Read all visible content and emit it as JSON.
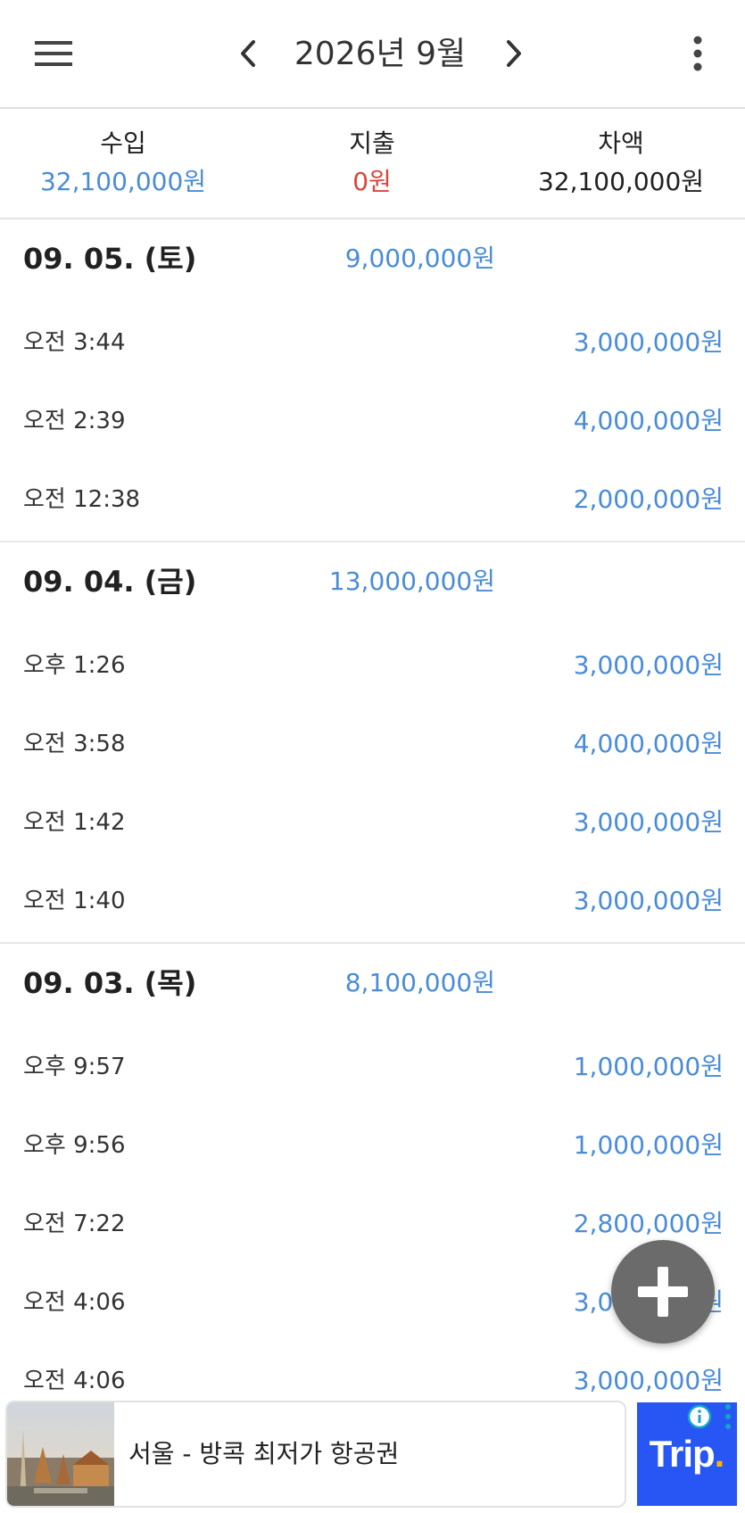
{
  "header": {
    "title": "2026년 9월",
    "menu_icon": "hamburger-menu-icon",
    "prev_icon": "chevron-left-icon",
    "next_icon": "chevron-right-icon",
    "more_icon": "more-vertical-icon"
  },
  "summary": {
    "income_label": "수입",
    "income_value": "32,100,000원",
    "expense_label": "지출",
    "expense_value": "0원",
    "balance_label": "차액",
    "balance_value": "32,100,000원"
  },
  "colors": {
    "income": "#4a8cd6",
    "expense": "#d9453b",
    "fab": "#6b6b6b",
    "ad_logo_bg": "#2756f5"
  },
  "days": [
    {
      "date": "09. 05. (토)",
      "total": "9,000,000원",
      "transactions": [
        {
          "time": "오전 3:44",
          "amount": "3,000,000원"
        },
        {
          "time": "오전 2:39",
          "amount": "4,000,000원"
        },
        {
          "time": "오전 12:38",
          "amount": "2,000,000원"
        }
      ]
    },
    {
      "date": "09. 04. (금)",
      "total": "13,000,000원",
      "transactions": [
        {
          "time": "오후 1:26",
          "amount": "3,000,000원"
        },
        {
          "time": "오전 3:58",
          "amount": "4,000,000원"
        },
        {
          "time": "오전 1:42",
          "amount": "3,000,000원"
        },
        {
          "time": "오전 1:40",
          "amount": "3,000,000원"
        }
      ]
    },
    {
      "date": "09. 03. (목)",
      "total": "8,100,000원",
      "transactions": [
        {
          "time": "오후 9:57",
          "amount": "1,000,000원"
        },
        {
          "time": "오후 9:56",
          "amount": "1,000,000원"
        },
        {
          "time": "오전 7:22",
          "amount": "2,800,000원"
        },
        {
          "time": "오전 4:06",
          "amount": "3,000,000원"
        },
        {
          "time": "오전 4:06",
          "amount": "3,000,000원"
        }
      ]
    }
  ],
  "fab": {
    "icon": "plus-icon"
  },
  "ad": {
    "text": "서울 - 방콕 최저가 항공권",
    "logo_text": "Trip",
    "logo_dot": ".",
    "info_icon": "info-icon",
    "more_icon": "more-vertical-icon"
  }
}
